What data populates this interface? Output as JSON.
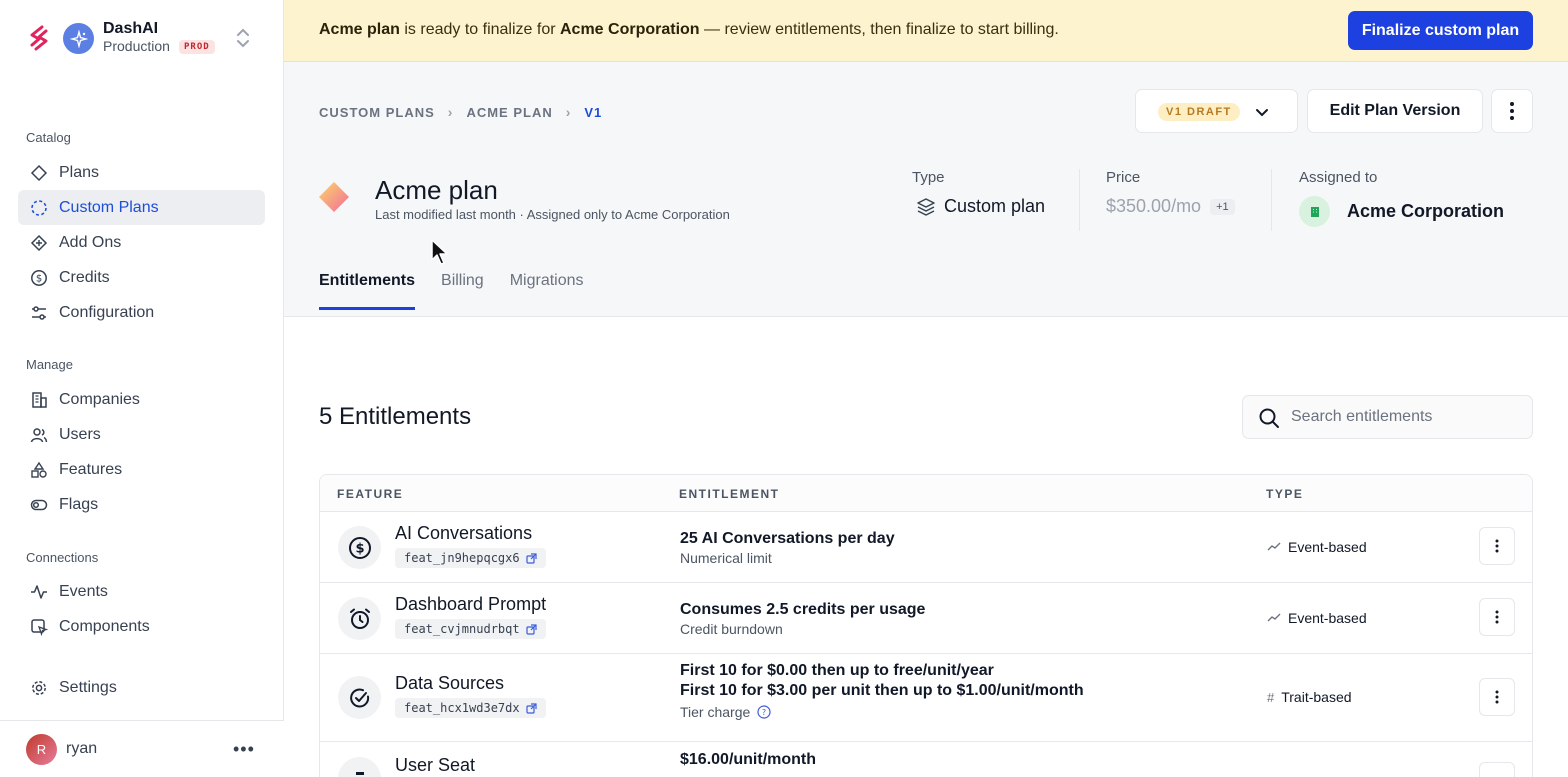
{
  "org": {
    "name": "DashAI",
    "environment": "Production",
    "env_badge": "PROD"
  },
  "sidebar": {
    "sections": [
      {
        "title": "Catalog",
        "items": [
          {
            "label": "Plans",
            "icon": "diamond-icon"
          },
          {
            "label": "Custom Plans",
            "icon": "dashed-circle-icon",
            "active": true
          },
          {
            "label": "Add Ons",
            "icon": "diamond-plus-icon"
          },
          {
            "label": "Credits",
            "icon": "dollar-circle-icon"
          },
          {
            "label": "Configuration",
            "icon": "sliders-icon"
          }
        ]
      },
      {
        "title": "Manage",
        "items": [
          {
            "label": "Companies",
            "icon": "building-icon"
          },
          {
            "label": "Users",
            "icon": "users-icon"
          },
          {
            "label": "Features",
            "icon": "shapes-icon"
          },
          {
            "label": "Flags",
            "icon": "toggle-icon"
          }
        ]
      },
      {
        "title": "Connections",
        "items": [
          {
            "label": "Events",
            "icon": "activity-icon"
          },
          {
            "label": "Components",
            "icon": "component-icon"
          }
        ]
      },
      {
        "title": "",
        "items": [
          {
            "label": "Settings",
            "icon": "gear-icon"
          }
        ]
      }
    ],
    "user": {
      "initial": "R",
      "name": "ryan"
    }
  },
  "banner": {
    "plan": "Acme plan",
    "text_1": " is ready to finalize for ",
    "company": "Acme Corporation",
    "text_2": " — review entitlements, then finalize to start billing.",
    "cta": "Finalize custom plan"
  },
  "breadcrumb": [
    "CUSTOM PLANS",
    "ACME PLAN",
    "V1"
  ],
  "version_select": {
    "value": "V1 DRAFT"
  },
  "edit_button": "Edit Plan Version",
  "plan": {
    "title": "Acme plan",
    "subtitle": "Last modified last month · Assigned only to Acme Corporation"
  },
  "meta": {
    "type_label": "Type",
    "type_value": "Custom plan",
    "price_label": "Price",
    "price_value": "$350.00/mo",
    "price_extra": "+1",
    "assigned_label": "Assigned to",
    "assigned_value": "Acme Corporation"
  },
  "tabs": [
    "Entitlements",
    "Billing",
    "Migrations"
  ],
  "entitlements": {
    "count_label": "5 Entitlements",
    "search_placeholder": "Search entitlements",
    "columns": [
      "FEATURE",
      "ENTITLEMENT",
      "TYPE"
    ],
    "rows": [
      {
        "name": "AI Conversations",
        "id": "feat_jn9hepqcgx6",
        "icon": "dollar-circle-icon",
        "line1": "25 AI Conversations per day",
        "line2": "Numerical limit",
        "type": "Event-based",
        "type_icon": "trend-icon"
      },
      {
        "name": "Dashboard Prompt",
        "id": "feat_cvjmnudrbqt",
        "icon": "alarm-clock-icon",
        "line1": "Consumes 2.5 credits per usage",
        "line2": "Credit burndown",
        "type": "Event-based",
        "type_icon": "trend-icon"
      },
      {
        "name": "Data Sources",
        "id": "feat_hcx1wd3e7dx",
        "icon": "check-circle-icon",
        "line1": "First 10 for $0.00 then up to free/unit/year",
        "line1b": "First 10 for $3.00 per unit then up to $1.00/unit/month",
        "line2": "Tier charge",
        "type": "Trait-based",
        "type_icon": "hash-icon"
      },
      {
        "name": "User Seat",
        "line1": "$16.00/unit/month"
      }
    ]
  }
}
